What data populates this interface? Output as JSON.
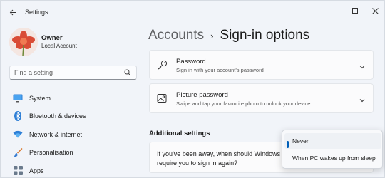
{
  "window": {
    "title": "Settings",
    "accent_color": "#005fb8"
  },
  "profile": {
    "name": "Owner",
    "account_type": "Local Account",
    "avatar_icon": "flower-avatar"
  },
  "search": {
    "placeholder": "Find a setting",
    "value": "",
    "icon": "search-icon"
  },
  "sidebar": {
    "items": [
      {
        "label": "System",
        "icon": "monitor-icon"
      },
      {
        "label": "Bluetooth & devices",
        "icon": "bluetooth-icon"
      },
      {
        "label": "Network & internet",
        "icon": "wifi-icon"
      },
      {
        "label": "Personalisation",
        "icon": "brush-icon"
      },
      {
        "label": "Apps",
        "icon": "apps-icon"
      }
    ]
  },
  "breadcrumb": {
    "parent": "Accounts",
    "separator": "›",
    "current": "Sign-in options"
  },
  "cards": [
    {
      "title": "Password",
      "subtitle": "Sign in with your account's password",
      "icon": "key-icon"
    },
    {
      "title": "Picture password",
      "subtitle": "Swipe and tap your favourite photo to unlock your device",
      "icon": "picture-icon"
    }
  ],
  "additional": {
    "heading": "Additional settings",
    "question_line1": "If you've been away, when should Windows",
    "question_line2": "require you to sign in again?"
  },
  "dropdown": {
    "options": [
      "Never",
      "When PC wakes up from sleep"
    ],
    "selected": "Never"
  }
}
